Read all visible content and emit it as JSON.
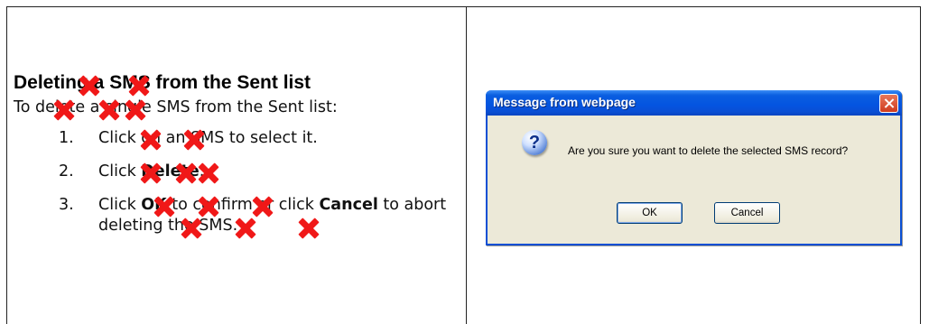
{
  "left_panel": {
    "heading": "Deleting a SMS from the Sent list",
    "intro": "To delete a single SMS from the Sent list:",
    "steps": [
      {
        "num": "1.",
        "prefix": "Click on an SMS to select it.",
        "kw": "",
        "suffix": ""
      },
      {
        "num": "2.",
        "prefix": "Click ",
        "kw": "Delete",
        "suffix": "."
      },
      {
        "num": "3.",
        "prefix": "Click ",
        "kw": "OK",
        "suffix": " to confirm or click ",
        "kw2": "Cancel",
        "suffix2": " to abort deleting the SMS."
      }
    ]
  },
  "dialog": {
    "title": "Message from webpage",
    "message": "Are you sure you want to delete the selected SMS record?",
    "icon": "question-icon",
    "ok_label": "OK",
    "cancel_label": "Cancel"
  },
  "colors": {
    "titlebar": "#0a4fd4",
    "dialog_bg": "#ece9d8",
    "cross_marks": "#f01818"
  }
}
